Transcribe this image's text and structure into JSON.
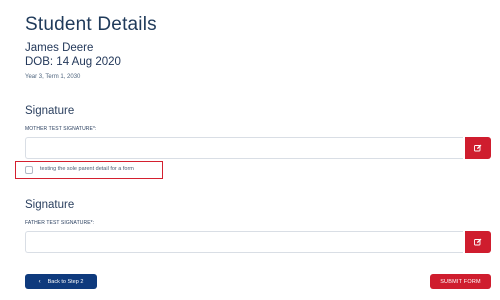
{
  "student": {
    "heading": "Student Details",
    "name": "James Deere",
    "dob": "DOB: 14 Aug 2020",
    "term": "Year 3, Term 1, 2030"
  },
  "signatures": [
    {
      "heading": "Signature",
      "field_label": "MOTHER TEST SIGNATURE*:",
      "value": "",
      "edit_icon": "edit-icon"
    },
    {
      "heading": "Signature",
      "field_label": "FATHER TEST SIGNATURE*:",
      "value": "",
      "edit_icon": "edit-icon"
    }
  ],
  "checkbox": {
    "label": "testing the sole parent detail for a form",
    "checked": false
  },
  "actions": {
    "back_icon": "chevron-left-icon",
    "back_label": "Back to Step 2",
    "submit_label": "SUBMIT FORM"
  },
  "colors": {
    "accent_red": "#cf1d2e",
    "navy": "#0e3a7d",
    "highlight_outline": "#d4202f"
  }
}
